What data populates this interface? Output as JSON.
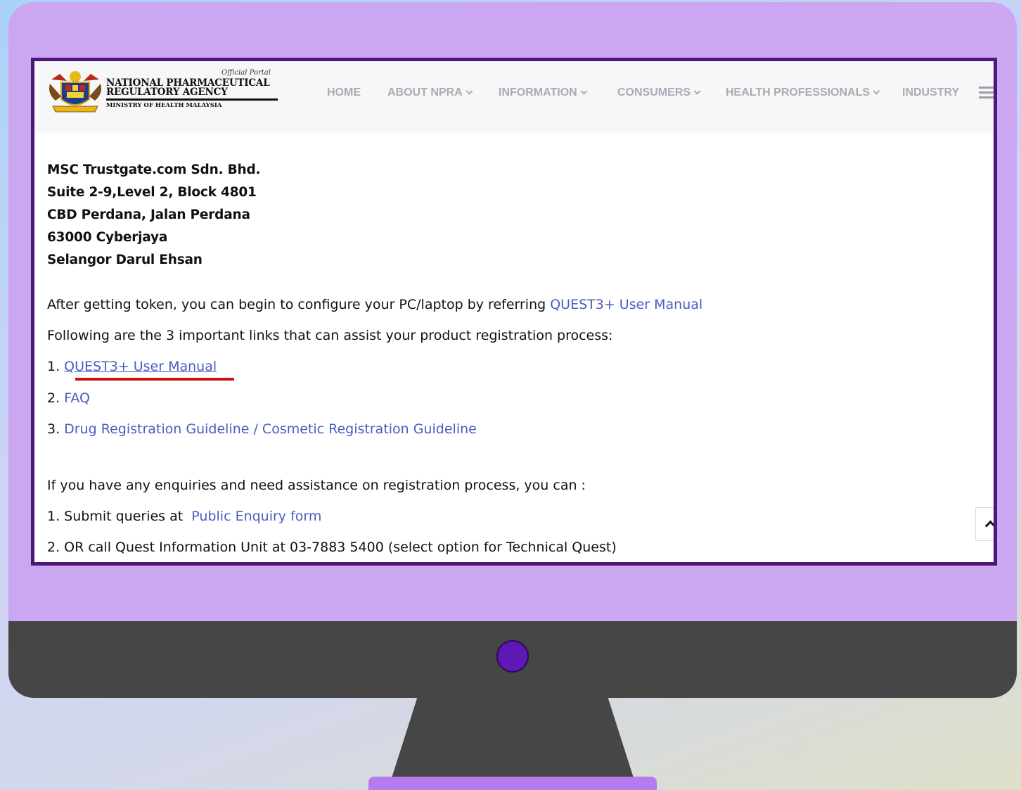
{
  "site": {
    "logo": {
      "official": "Official Portal",
      "line1": "NATIONAL PHARMACEUTICAL",
      "line2": "REGULATORY AGENCY",
      "line3": "MINISTRY OF HEALTH MALAYSIA"
    },
    "nav": {
      "home": "HOME",
      "about": "ABOUT NPRA",
      "information": "INFORMATION",
      "consumers": "CONSUMERS",
      "health_professionals": "HEALTH PROFESSIONALS",
      "industry": "INDUSTRY"
    },
    "nav_icons": {
      "dropdown": "chevron-down-icon",
      "menu": "hamburger-icon",
      "scroll_top": "chevron-up-icon"
    }
  },
  "content": {
    "address": [
      "MSC Trustgate.com Sdn. Bhd.",
      "Suite 2-9,Level 2, Block 4801",
      "CBD Perdana, Jalan Perdana",
      "63000 Cyberjaya",
      "Selangor Darul Ehsan"
    ],
    "configure_text": "After getting token, you can begin to configure your PC/laptop by referring ",
    "configure_link": "QUEST3+ User Manual",
    "links_intro": "Following are the 3 important links that can assist your product registration process:",
    "links": [
      {
        "prefix": "1. ",
        "label": "QUEST3+ User Manual"
      },
      {
        "prefix": "2. ",
        "label": "FAQ"
      },
      {
        "prefix": "3. ",
        "label": "Drug Registration Guideline / Cosmetic Registration Guideline"
      }
    ],
    "enquiry_intro": "If you have any enquiries and need assistance on registration process, you can :",
    "enquiry_1_prefix": "1. Submit queries at ",
    "enquiry_1_link": "Public Enquiry form",
    "enquiry_2": "2. OR call Quest Information Unit at 03-7883 5400 (select option for Technical Quest)"
  },
  "colors": {
    "link": "#4a5cc0",
    "highlight": "#cc1111",
    "monitor_frame": "#cba7f2",
    "screen_border": "#4f157b",
    "chin": "#464646",
    "power_button": "#5e18b8"
  }
}
